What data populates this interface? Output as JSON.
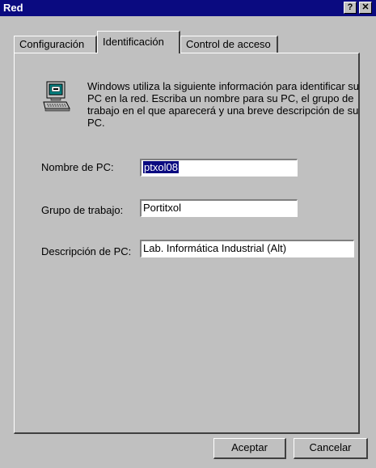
{
  "window": {
    "title": "Red",
    "help_label": "?",
    "close_label": "✕"
  },
  "tabs": [
    {
      "label": "Configuración"
    },
    {
      "label": "Identificación"
    },
    {
      "label": "Control de acceso"
    }
  ],
  "icon": "computer-icon",
  "description": "Windows utiliza la siguiente información para identificar su PC en la red. Escriba un nombre para su PC, el grupo de trabajo en el que aparecerá y una breve descripción de su PC.",
  "fields": {
    "computer_name": {
      "label": "Nombre de PC:",
      "value": "ptxol08"
    },
    "workgroup": {
      "label": "Grupo de trabajo:",
      "value": "Portitxol"
    },
    "description": {
      "label": "Descripción de PC:",
      "value": "Lab. Informática Industrial (Alt)"
    }
  },
  "buttons": {
    "ok": "Aceptar",
    "cancel": "Cancelar"
  },
  "colors": {
    "titlebar": "#0a0a80",
    "face": "#c0c0c0",
    "selection": "#0a0a80"
  }
}
